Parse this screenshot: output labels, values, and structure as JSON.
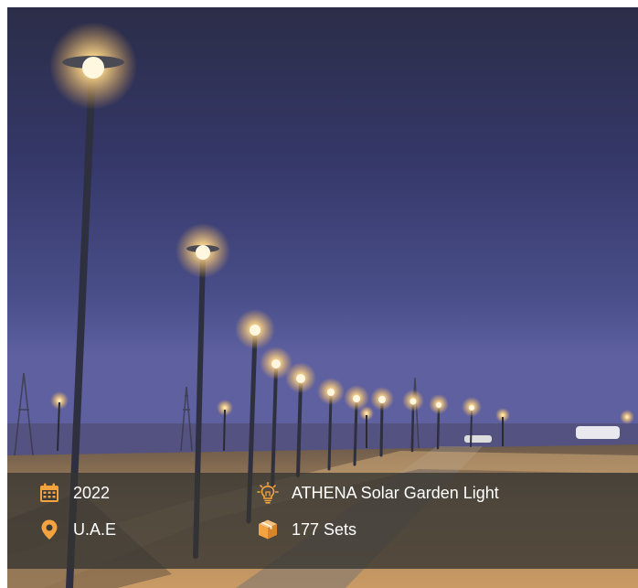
{
  "project": {
    "year": "2022",
    "location": "U.A.E",
    "product": "ATHENA Solar Garden Light",
    "quantity": "177 Sets"
  },
  "icons": {
    "year": "calendar-icon",
    "location": "map-pin-icon",
    "product": "lightbulb-icon",
    "quantity": "package-icon"
  },
  "colors": {
    "accent": "#f4a340",
    "overlay": "#343432",
    "text": "#ffffff"
  }
}
